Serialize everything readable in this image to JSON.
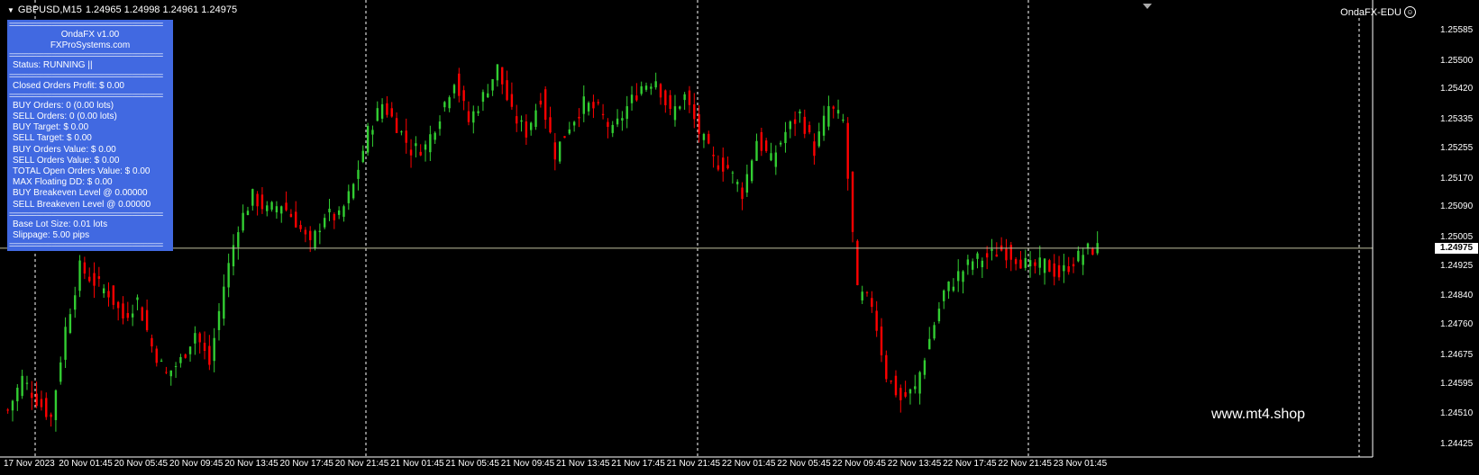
{
  "header": {
    "symbol": "GBPUSD,M15",
    "quotes": "1.24965 1.24998 1.24961 1.24975"
  },
  "expert": {
    "name": "OndaFX-EDU",
    "status_icon": "smiley-icon"
  },
  "panel": {
    "sep": "========================================",
    "title": "OndaFX v1.00",
    "site": "FXProSystems.com",
    "status": "Status: RUNNING ||",
    "closed_profit": "Closed Orders Profit: $ 0.00",
    "stats": [
      "BUY Orders: 0 (0.00 lots)",
      "SELL Orders: 0 (0.00 lots)",
      "BUY Target: $ 0.00",
      "SELL Target: $ 0.00",
      "BUY Orders Value: $ 0.00",
      "SELL Orders Value: $ 0.00",
      "TOTAL Open Orders Value: $ 0.00",
      "MAX Floating DD: $ 0.00",
      "BUY Breakeven Level @ 0.00000",
      "SELL Breakeven Level @ 0.00000"
    ],
    "base_lot": "Base Lot Size: 0.01 lots",
    "slippage": "Slippage: 5.00 pips"
  },
  "watermark": "www.mt4.shop",
  "colors": {
    "bull": "#32cd32",
    "bear": "#ff0000",
    "bid_line": "#c0c0a0",
    "panel": "#4169e1"
  },
  "chart_data": {
    "type": "candlestick",
    "ylim": [
      1.2441,
      1.2562
    ],
    "current_price": "1.24975",
    "price_ticks": [
      "1.25585",
      "1.25500",
      "1.25420",
      "1.25335",
      "1.25255",
      "1.25170",
      "1.25090",
      "1.25005",
      "1.24925",
      "1.24840",
      "1.24760",
      "1.24675",
      "1.24595",
      "1.24510",
      "1.24425"
    ],
    "time_ticks": [
      "17 Nov 2023",
      "20 Nov 01:45",
      "20 Nov 05:45",
      "20 Nov 09:45",
      "20 Nov 13:45",
      "20 Nov 17:45",
      "20 Nov 21:45",
      "21 Nov 01:45",
      "21 Nov 05:45",
      "21 Nov 09:45",
      "21 Nov 13:45",
      "21 Nov 17:45",
      "21 Nov 21:45",
      "22 Nov 01:45",
      "22 Nov 05:45",
      "22 Nov 09:45",
      "22 Nov 13:45",
      "22 Nov 17:45",
      "22 Nov 21:45",
      "23 Nov 01:45"
    ],
    "close_path": [
      [
        0,
        1.2452
      ],
      [
        3,
        1.2461
      ],
      [
        6,
        1.2455
      ],
      [
        9,
        1.245
      ],
      [
        12,
        1.2475
      ],
      [
        15,
        1.2492
      ],
      [
        18,
        1.2488
      ],
      [
        21,
        1.2485
      ],
      [
        24,
        1.2478
      ],
      [
        27,
        1.2483
      ],
      [
        30,
        1.247
      ],
      [
        33,
        1.2462
      ],
      [
        36,
        1.2466
      ],
      [
        39,
        1.2474
      ],
      [
        42,
        1.2465
      ],
      [
        45,
        1.2487
      ],
      [
        48,
        1.2504
      ],
      [
        51,
        1.2512
      ],
      [
        54,
        1.2508
      ],
      [
        57,
        1.251
      ],
      [
        60,
        1.2505
      ],
      [
        63,
        1.2498
      ],
      [
        66,
        1.2507
      ],
      [
        69,
        1.2506
      ],
      [
        72,
        1.2515
      ],
      [
        75,
        1.253
      ],
      [
        78,
        1.2538
      ],
      [
        81,
        1.2532
      ],
      [
        84,
        1.2525
      ],
      [
        87,
        1.2526
      ],
      [
        90,
        1.2535
      ],
      [
        93,
        1.2545
      ],
      [
        96,
        1.2533
      ],
      [
        99,
        1.254
      ],
      [
        102,
        1.2548
      ],
      [
        105,
        1.2535
      ],
      [
        108,
        1.253
      ],
      [
        111,
        1.254
      ],
      [
        114,
        1.2524
      ],
      [
        117,
        1.2532
      ],
      [
        120,
        1.2538
      ],
      [
        123,
        1.2536
      ],
      [
        126,
        1.253
      ],
      [
        129,
        1.2537
      ],
      [
        132,
        1.2543
      ],
      [
        135,
        1.2545
      ],
      [
        138,
        1.2535
      ],
      [
        141,
        1.254
      ],
      [
        144,
        1.253
      ],
      [
        147,
        1.2522
      ],
      [
        150,
        1.252
      ],
      [
        153,
        1.2513
      ],
      [
        156,
        1.2528
      ],
      [
        159,
        1.2522
      ],
      [
        162,
        1.253
      ],
      [
        165,
        1.2535
      ],
      [
        168,
        1.2525
      ],
      [
        171,
        1.2537
      ],
      [
        174,
        1.2533
      ],
      [
        177,
        1.2485
      ],
      [
        180,
        1.2482
      ],
      [
        183,
        1.2462
      ],
      [
        186,
        1.2455
      ],
      [
        189,
        1.2458
      ],
      [
        192,
        1.2472
      ],
      [
        195,
        1.2485
      ],
      [
        198,
        1.249
      ],
      [
        201,
        1.2494
      ],
      [
        204,
        1.2495
      ],
      [
        207,
        1.2497
      ],
      [
        210,
        1.2495
      ],
      [
        213,
        1.2492
      ],
      [
        216,
        1.2493
      ],
      [
        219,
        1.249
      ],
      [
        222,
        1.2494
      ],
      [
        225,
        1.2497
      ],
      [
        227,
        1.24975
      ]
    ]
  }
}
